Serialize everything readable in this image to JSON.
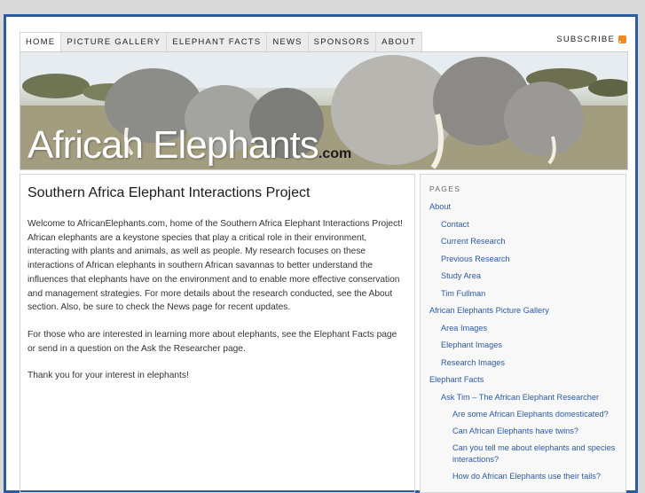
{
  "nav": {
    "items": [
      "Home",
      "Picture Gallery",
      "Elephant Facts",
      "News",
      "Sponsors",
      "About"
    ],
    "subscribe": "SUBSCRIBE"
  },
  "banner": {
    "title": "African Elephants",
    "suffix": ".com"
  },
  "main": {
    "title": "Southern Africa Elephant Interactions Project",
    "paragraphs": [
      "Welcome to AfricanElephants.com, home of the Southern Africa Elephant Interactions Project! African elephants are a keystone species that play a critical role in their environment, interacting with plants and animals, as well as people. My research focuses on these interactions of African elephants in southern African savannas to better understand the influences that elephants have on the environment and to enable more effective conservation and management strategies. For more details about the research conducted, see the About section. Also, be sure to check the News page for recent updates.",
      "For those who are interested in learning more about elephants, see the Elephant Facts page or send in a question on the Ask the Researcher page.",
      "Thank you for your interest in elephants!"
    ]
  },
  "sidebar": {
    "heading": "Pages",
    "links": [
      {
        "label": "About",
        "level": 1
      },
      {
        "label": "Contact",
        "level": 2
      },
      {
        "label": "Current Research",
        "level": 2
      },
      {
        "label": "Previous Research",
        "level": 2
      },
      {
        "label": "Study Area",
        "level": 2
      },
      {
        "label": "Tim Fullman",
        "level": 2
      },
      {
        "label": "African Elephants Picture Gallery",
        "level": 1
      },
      {
        "label": "Area Images",
        "level": 2
      },
      {
        "label": "Elephant Images",
        "level": 2
      },
      {
        "label": "Research Images",
        "level": 2
      },
      {
        "label": "Elephant Facts",
        "level": 1
      },
      {
        "label": "Ask Tim – The African Elephant Researcher",
        "level": 2
      },
      {
        "label": "Are some African Elephants domesticated?",
        "level": 3
      },
      {
        "label": "Can African Elephants have twins?",
        "level": 3
      },
      {
        "label": "Can you tell me about elephants and species interactions?",
        "level": 3
      },
      {
        "label": "How do African Elephants use their tails?",
        "level": 3
      }
    ]
  },
  "colors": {
    "frame": "#2c5b9e",
    "link": "#2a5aa3"
  }
}
